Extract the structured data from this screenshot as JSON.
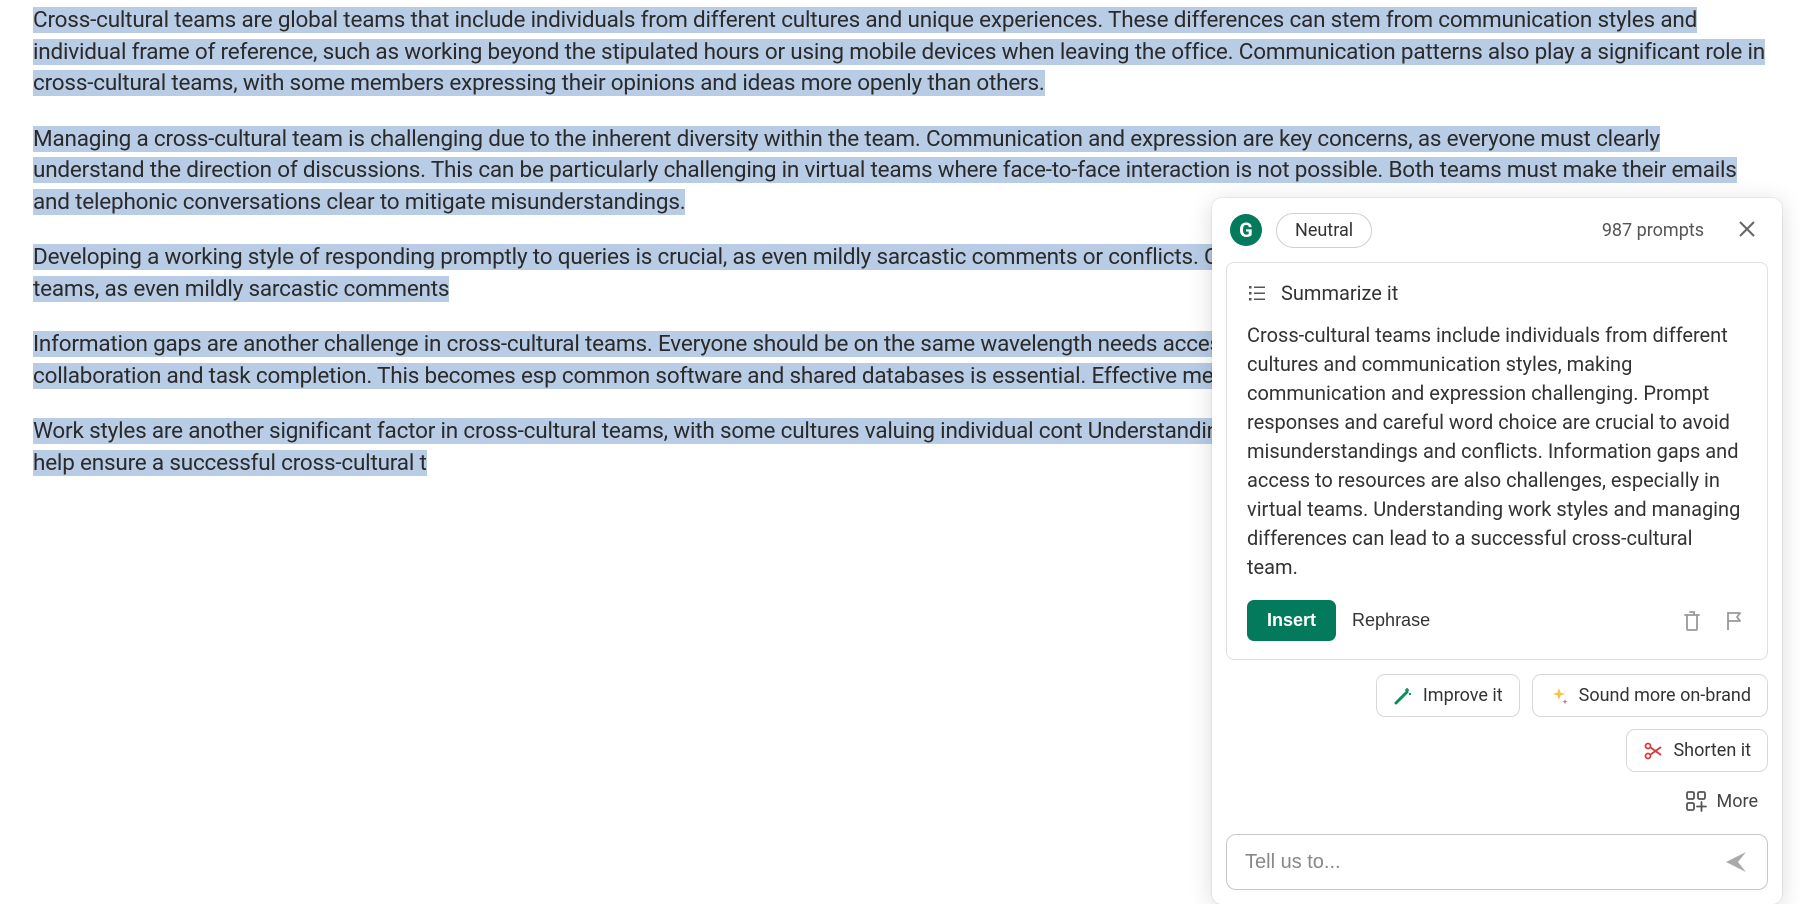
{
  "document": {
    "paragraphs": [
      "Cross-cultural teams are global teams that include individuals from different cultures and unique experiences. These differences can stem from communication styles and individual frame of reference, such as working beyond the stipulated hours or using mobile devices when leaving the office. Communication patterns also play a significant role in cross-cultural teams, with some members expressing their opinions and ideas more openly than others.",
      "Managing a cross-cultural team is challenging due to the inherent diversity within the team. Communication and expression are key concerns, as everyone must clearly understand the direction of discussions. This can be particularly challenging in virtual teams where face-to-face interaction is not possible. Both teams must make their emails and telephonic conversations clear to mitigate misunderstandings.",
      "Developing a working style of responding promptly to queries is crucial, as even mildly sarcastic comments or conflicts. Care must be taken with the words used in cross-cultural teams, as even mildly sarcastic comments",
      "Information gaps are another challenge in cross-cultural teams. Everyone should be on the same wavelength needs access to the right resources at the right time for collaboration and task completion. This becomes esp common software and shared databases is essential. Effective means to share resources and access them in a",
      "Work styles are another significant factor in cross-cultural teams, with some cultures valuing individual cont Understanding these differences and managing them effectively can help ensure a successful cross-cultural t"
    ]
  },
  "panel": {
    "logo": "G",
    "tone": "Neutral",
    "prompts_count": "987 prompts",
    "summarize_title": "Summarize it",
    "summary_text": "Cross-cultural teams include individuals from different cultures and communication styles, making communication and expression challenging. Prompt responses and careful word choice are crucial to avoid misunderstandings and conflicts. Information gaps and access to resources are also challenges, especially in virtual teams. Understanding work styles and managing differences can lead to a successful cross-cultural team.",
    "insert_label": "Insert",
    "rephrase_label": "Rephrase",
    "suggestions": {
      "improve": "Improve it",
      "onbrand": "Sound more on-brand",
      "shorten": "Shorten it"
    },
    "more_label": "More",
    "input_placeholder": "Tell us to..."
  }
}
